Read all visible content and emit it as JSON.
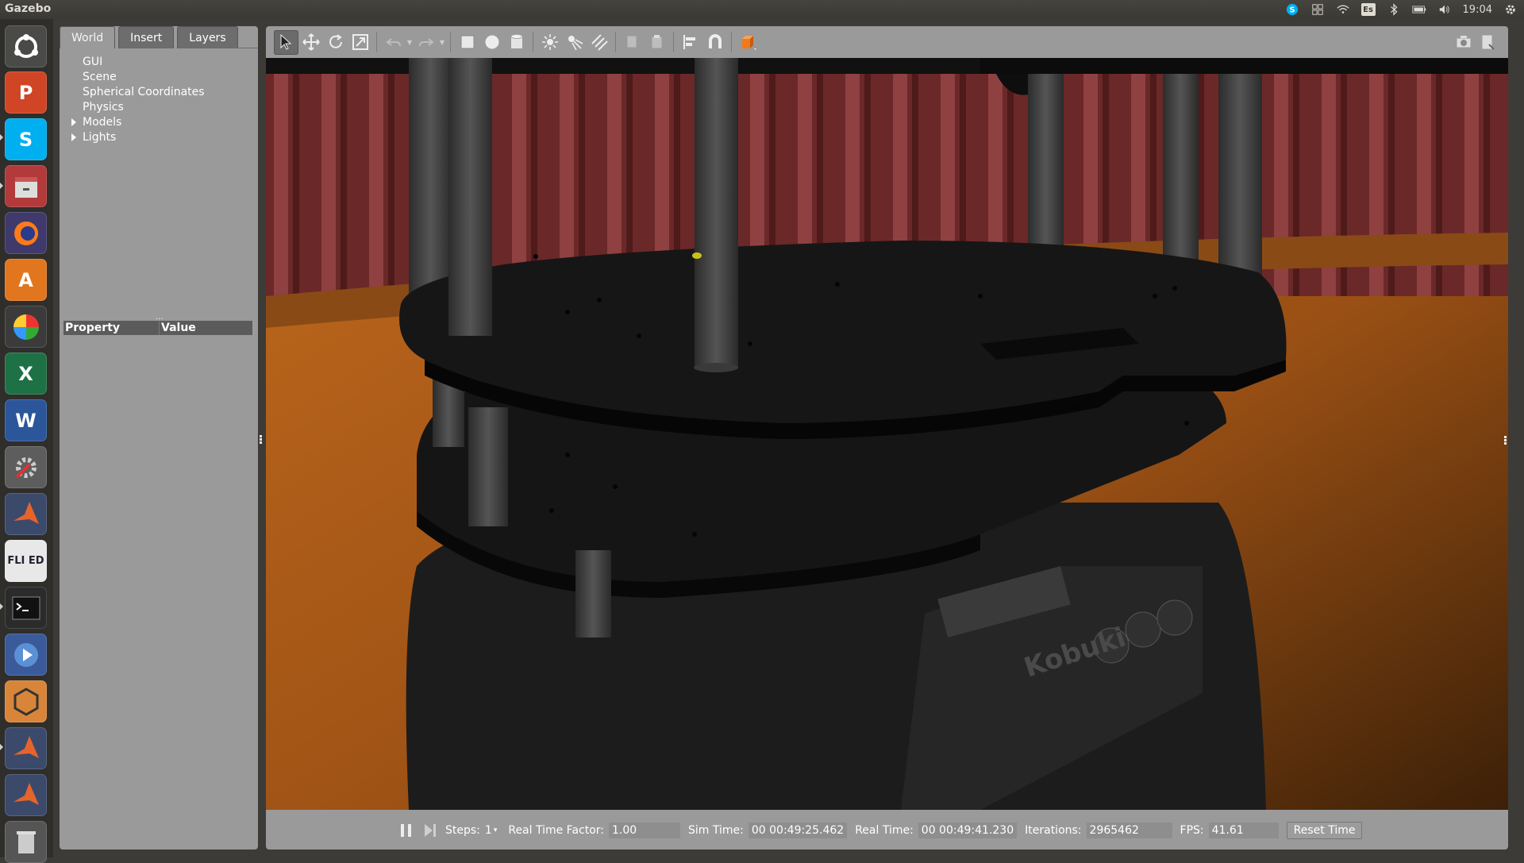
{
  "topbar": {
    "title": "Gazebo",
    "keyboard_layout": "Es",
    "clock": "19:04",
    "icons": [
      "skype-tray-icon",
      "workspace-switcher-icon",
      "wifi-icon",
      "keyboard-layout-icon",
      "bluetooth-icon",
      "battery-icon",
      "volume-icon",
      "session-gear-icon"
    ]
  },
  "launcher": {
    "items": [
      "ubuntu-dash",
      "powerpoint",
      "skype",
      "files",
      "firefox",
      "software-center",
      "photos",
      "excel",
      "word",
      "system-settings",
      "matlab",
      "fluxed",
      "terminal",
      "media-player",
      "virtualbox",
      "matlab-2",
      "matlab-3",
      "trash"
    ]
  },
  "left_panel": {
    "tabs": [
      "World",
      "Insert",
      "Layers"
    ],
    "active_tab": "World",
    "tree": [
      {
        "label": "GUI",
        "expandable": false
      },
      {
        "label": "Scene",
        "expandable": false
      },
      {
        "label": "Spherical Coordinates",
        "expandable": false
      },
      {
        "label": "Physics",
        "expandable": false
      },
      {
        "label": "Models",
        "expandable": true
      },
      {
        "label": "Lights",
        "expandable": true
      }
    ],
    "property_header": {
      "col1": "Property",
      "col2": "Value"
    }
  },
  "toolbar": {
    "tools": [
      "select-mode",
      "translate-mode",
      "rotate-mode",
      "scale-mode",
      "undo",
      "redo",
      "box-shape",
      "sphere-shape",
      "cylinder-shape",
      "point-light",
      "spot-light",
      "directional-light",
      "copy",
      "paste",
      "align",
      "snap",
      "change-view"
    ],
    "right_tools": [
      "screenshot",
      "log-data"
    ]
  },
  "bottom_bar": {
    "steps_label": "Steps:",
    "steps_value": "1",
    "rtf_label": "Real Time Factor:",
    "rtf_value": "1.00",
    "sim_time_label": "Sim Time:",
    "sim_time_value": "00 00:49:25.462",
    "real_time_label": "Real Time:",
    "real_time_value": "00 00:49:41.230",
    "iterations_label": "Iterations:",
    "iterations_value": "2965462",
    "fps_label": "FPS:",
    "fps_value": "41.61",
    "reset_label": "Reset Time"
  },
  "colors": {
    "panel": "#9a9a9a",
    "curtain": "#7a2e2e",
    "floor": "#b5651d",
    "robot_plate": "#141414"
  }
}
